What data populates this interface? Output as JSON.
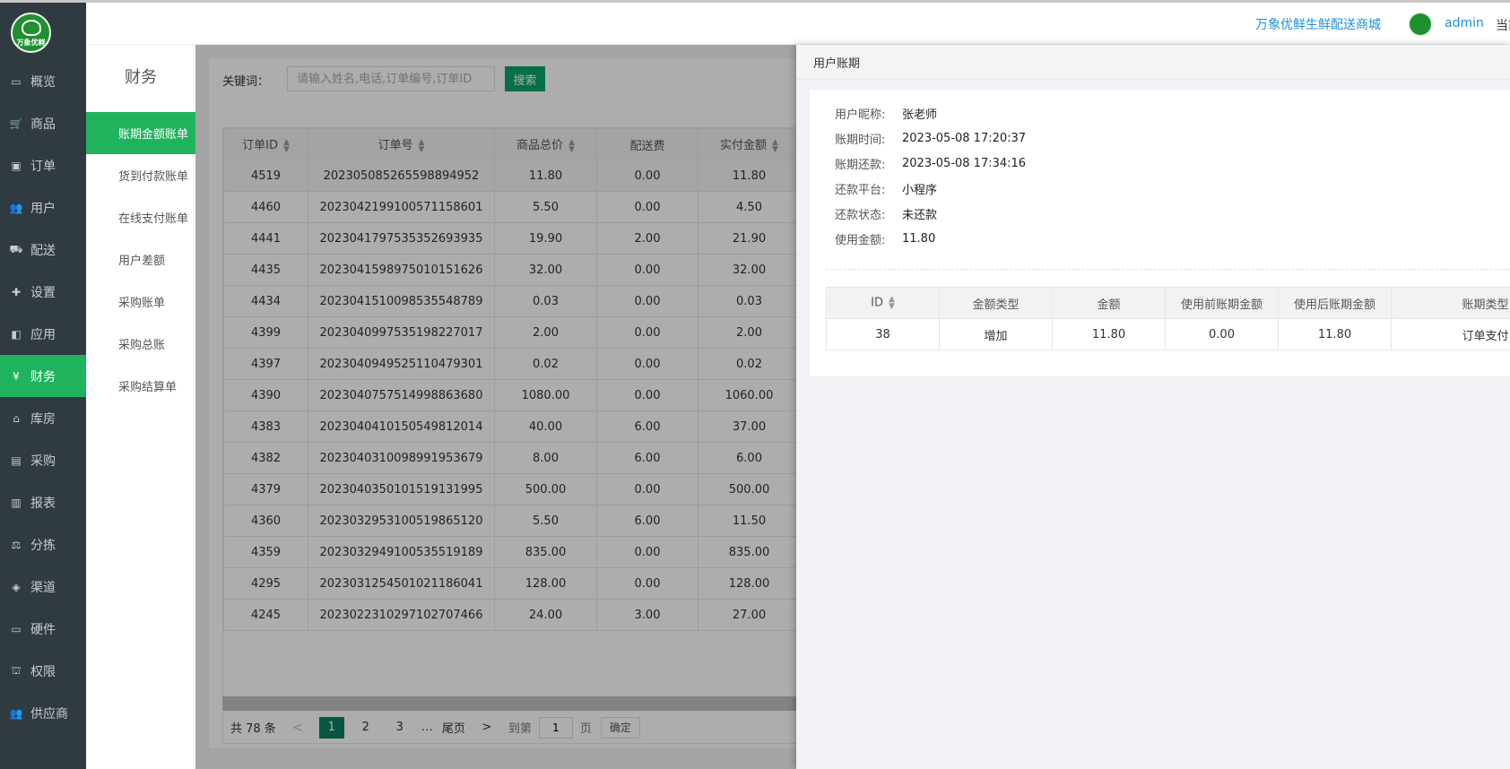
{
  "app": {
    "shop_link": "万象优鲜生鲜配送商城",
    "user": "admin",
    "current_label": "当前",
    "logo_text": "万象优鲜"
  },
  "colors": {
    "sidebar_bg": "#2f3a41",
    "active_green": "#1fb35d",
    "primary_button": "#07a66b",
    "link_blue": "#1e8fe0"
  },
  "sidebar": {
    "items": [
      {
        "label": "概览",
        "icon": "monitor-icon"
      },
      {
        "label": "商品",
        "icon": "cart-icon"
      },
      {
        "label": "订单",
        "icon": "money-icon"
      },
      {
        "label": "用户",
        "icon": "users-icon"
      },
      {
        "label": "配送",
        "icon": "truck-icon"
      },
      {
        "label": "设置",
        "icon": "puzzle-icon"
      },
      {
        "label": "应用",
        "icon": "apps-icon"
      },
      {
        "label": "财务",
        "icon": "yen-icon",
        "active": true
      },
      {
        "label": "库房",
        "icon": "home-icon"
      },
      {
        "label": "采购",
        "icon": "bus-icon"
      },
      {
        "label": "报表",
        "icon": "bar-chart-icon"
      },
      {
        "label": "分拣",
        "icon": "scale-icon"
      },
      {
        "label": "渠道",
        "icon": "cube-icon"
      },
      {
        "label": "硬件",
        "icon": "desktop-icon"
      },
      {
        "label": "权限",
        "icon": "bank-icon"
      },
      {
        "label": "供应商",
        "icon": "group-icon"
      }
    ]
  },
  "submenu": {
    "title": "财务",
    "items": [
      {
        "label": "账期金额账单",
        "active": true
      },
      {
        "label": "货到付款账单"
      },
      {
        "label": "在线支付账单"
      },
      {
        "label": "用户差额"
      },
      {
        "label": "采购账单"
      },
      {
        "label": "采购总账"
      },
      {
        "label": "采购结算单"
      }
    ]
  },
  "search": {
    "label": "关键词：",
    "placeholder": "请输入姓名,电话,订单编号,订单ID",
    "button": "搜索"
  },
  "orders": {
    "columns": [
      "订单ID",
      "订单号",
      "商品总价",
      "配送费",
      "实付金额"
    ],
    "rows": [
      [
        "4519",
        "202305085265598894952",
        "11.80",
        "0.00",
        "11.80"
      ],
      [
        "4460",
        "202304219910057115860​1",
        "5.50",
        "0.00",
        "4.50"
      ],
      [
        "4441",
        "202304179753535269393​5",
        "19.90",
        "2.00",
        "21.90"
      ],
      [
        "4435",
        "202304159897501015162​6",
        "32.00",
        "0.00",
        "32.00"
      ],
      [
        "4434",
        "202304151009853554878​9",
        "0.03",
        "0.00",
        "0.03"
      ],
      [
        "4399",
        "202304099753519822701​7",
        "2.00",
        "0.00",
        "2.00"
      ],
      [
        "4397",
        "202304094952511047930​1",
        "0.02",
        "0.00",
        "0.02"
      ],
      [
        "4390",
        "202304075751499886368​0",
        "1080.00",
        "0.00",
        "1060.00"
      ],
      [
        "4383",
        "202304041015054981201​4",
        "40.00",
        "6.00",
        "37.00"
      ],
      [
        "4382",
        "202304031009899195367​9",
        "8.00",
        "6.00",
        "6.00"
      ],
      [
        "4379",
        "202304035010151913199​5",
        "500.00",
        "0.00",
        "500.00"
      ],
      [
        "4360",
        "202303295310051986512​0",
        "5.50",
        "6.00",
        "11.50"
      ],
      [
        "4359",
        "202303294910053551918​9",
        "835.00",
        "0.00",
        "835.00"
      ],
      [
        "4295",
        "202303125450102118604​1",
        "128.00",
        "0.00",
        "128.00"
      ],
      [
        "4245",
        "202302231029710270746​6",
        "24.00",
        "3.00",
        "27.00"
      ]
    ]
  },
  "pager": {
    "total": "共 78 条",
    "prev": "<",
    "pages": [
      "1",
      "2",
      "3"
    ],
    "ellipsis": "…",
    "last": "尾页",
    "next": ">",
    "goto": "到第",
    "goto_value": "1",
    "page_unit": "页",
    "confirm": "确定"
  },
  "drawer": {
    "title": "用户账期",
    "fields": [
      {
        "label": "用户昵称:",
        "value": "张老师"
      },
      {
        "label": "账期时间:",
        "value": "2023-05-08 17:20:37"
      },
      {
        "label": "账期还款:",
        "value": "2023-05-08 17:34:16"
      },
      {
        "label": "还款平台:",
        "value": "小程序"
      },
      {
        "label": "还款状态:",
        "value": "未还款"
      },
      {
        "label": "使用金额:",
        "value": "11.80"
      }
    ],
    "columns": [
      "ID",
      "金额类型",
      "金额",
      "使用前账期金额",
      "使用后账期金额",
      "账期类型"
    ],
    "rows": [
      [
        "38",
        "增加",
        "11.80",
        "0.00",
        "11.80",
        "订单支付"
      ]
    ]
  }
}
